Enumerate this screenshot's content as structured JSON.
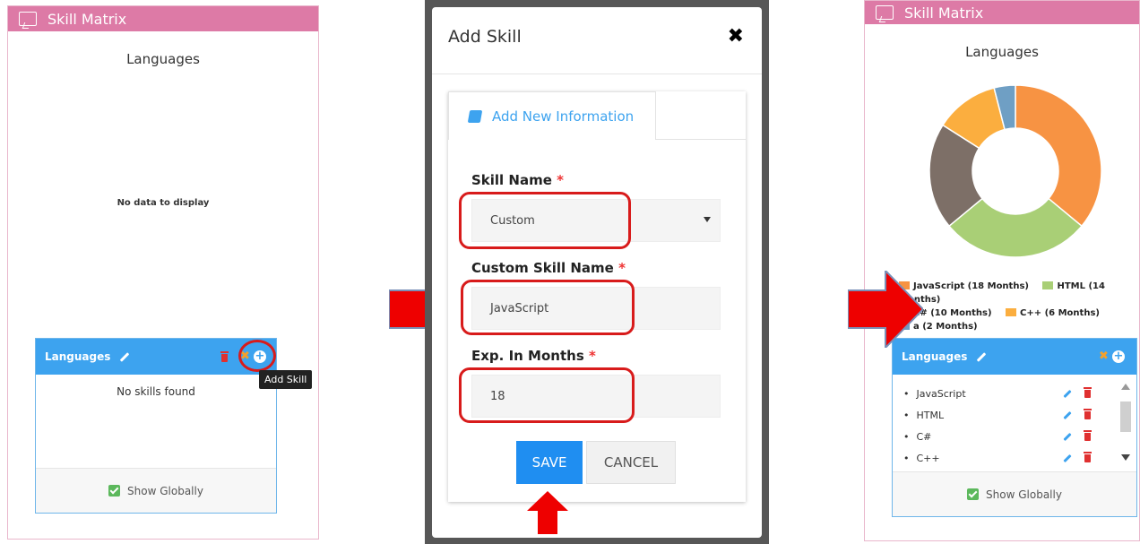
{
  "left_panel": {
    "header_title": "Skill Matrix",
    "chart_title": "Languages",
    "empty_chart_text": "No data to display",
    "card": {
      "title": "Languages",
      "empty_text": "No skills found",
      "tooltip": "Add Skill",
      "show_globally": "Show Globally"
    }
  },
  "modal": {
    "title": "Add Skill",
    "close_glyph": "✖",
    "tab_label": "Add New Information",
    "skill_name": {
      "label": "Skill Name",
      "value": "Custom"
    },
    "custom_skill_name": {
      "label": "Custom Skill Name",
      "value": "JavaScript"
    },
    "exp_months": {
      "label": "Exp. In Months",
      "value": "18"
    },
    "required_mark": "*",
    "save_label": "SAVE",
    "cancel_label": "CANCEL"
  },
  "right_panel": {
    "header_title": "Skill Matrix",
    "chart_title": "Languages",
    "card": {
      "title": "Languages",
      "skills": [
        "JavaScript",
        "HTML",
        "C#",
        "C++"
      ],
      "show_globally": "Show Globally"
    }
  },
  "chart_data": {
    "type": "pie",
    "title": "Languages",
    "categories": [
      "JavaScript (18 Months)",
      "HTML (14 Months)",
      "C# (10 Months)",
      "C++ (6 Months)",
      "a (2 Months)"
    ],
    "values": [
      18,
      14,
      10,
      6,
      2
    ],
    "colors": [
      "#f79343",
      "#a9cf76",
      "#7d6f67",
      "#fbae3f",
      "#6f9fc4"
    ],
    "donut": true,
    "legend_position": "bottom"
  }
}
